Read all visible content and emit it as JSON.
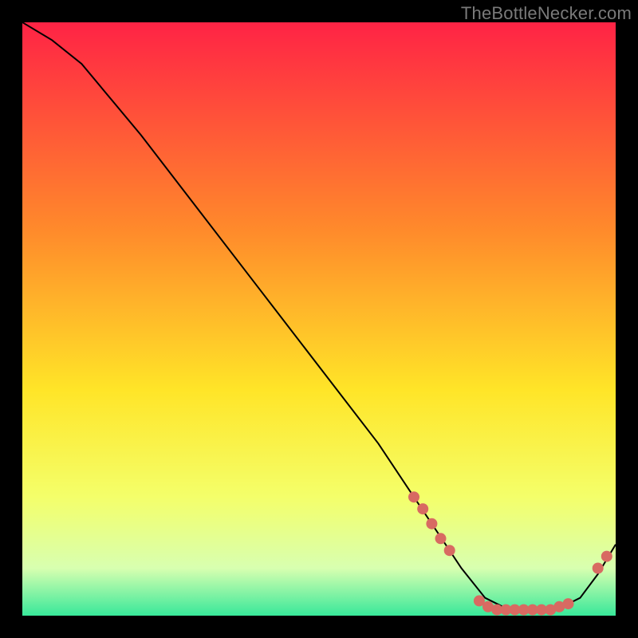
{
  "watermark": "TheBottleNecker.com",
  "colors": {
    "gradient_top": "#ff2345",
    "gradient_mid1": "#ff8a2b",
    "gradient_mid2": "#ffe528",
    "gradient_low": "#f4ff6a",
    "gradient_band_pale": "#d8ffb0",
    "gradient_band_green": "#38e89a",
    "marker": "#d86a62",
    "line": "#000000",
    "background": "#000000"
  },
  "chart_data": {
    "type": "line",
    "title": "",
    "xlabel": "",
    "ylabel": "",
    "xlim": [
      0,
      100
    ],
    "ylim": [
      0,
      100
    ],
    "series": [
      {
        "name": "curve",
        "x": [
          0,
          5,
          10,
          20,
          30,
          40,
          50,
          60,
          66,
          70,
          74,
          78,
          82,
          86,
          90,
          94,
          97,
          100
        ],
        "y": [
          100,
          97,
          93,
          81,
          68,
          55,
          42,
          29,
          20,
          14,
          8,
          3,
          1,
          1,
          1,
          3,
          7,
          12
        ]
      }
    ],
    "markers": [
      {
        "x": 66.0,
        "y": 20.0
      },
      {
        "x": 67.5,
        "y": 18.0
      },
      {
        "x": 69.0,
        "y": 15.5
      },
      {
        "x": 70.5,
        "y": 13.0
      },
      {
        "x": 72.0,
        "y": 11.0
      },
      {
        "x": 77.0,
        "y": 2.5
      },
      {
        "x": 78.5,
        "y": 1.5
      },
      {
        "x": 80.0,
        "y": 1.0
      },
      {
        "x": 81.5,
        "y": 1.0
      },
      {
        "x": 83.0,
        "y": 1.0
      },
      {
        "x": 84.5,
        "y": 1.0
      },
      {
        "x": 86.0,
        "y": 1.0
      },
      {
        "x": 87.5,
        "y": 1.0
      },
      {
        "x": 89.0,
        "y": 1.0
      },
      {
        "x": 90.5,
        "y": 1.5
      },
      {
        "x": 92.0,
        "y": 2.0
      },
      {
        "x": 97.0,
        "y": 8.0
      },
      {
        "x": 98.5,
        "y": 10.0
      }
    ]
  }
}
